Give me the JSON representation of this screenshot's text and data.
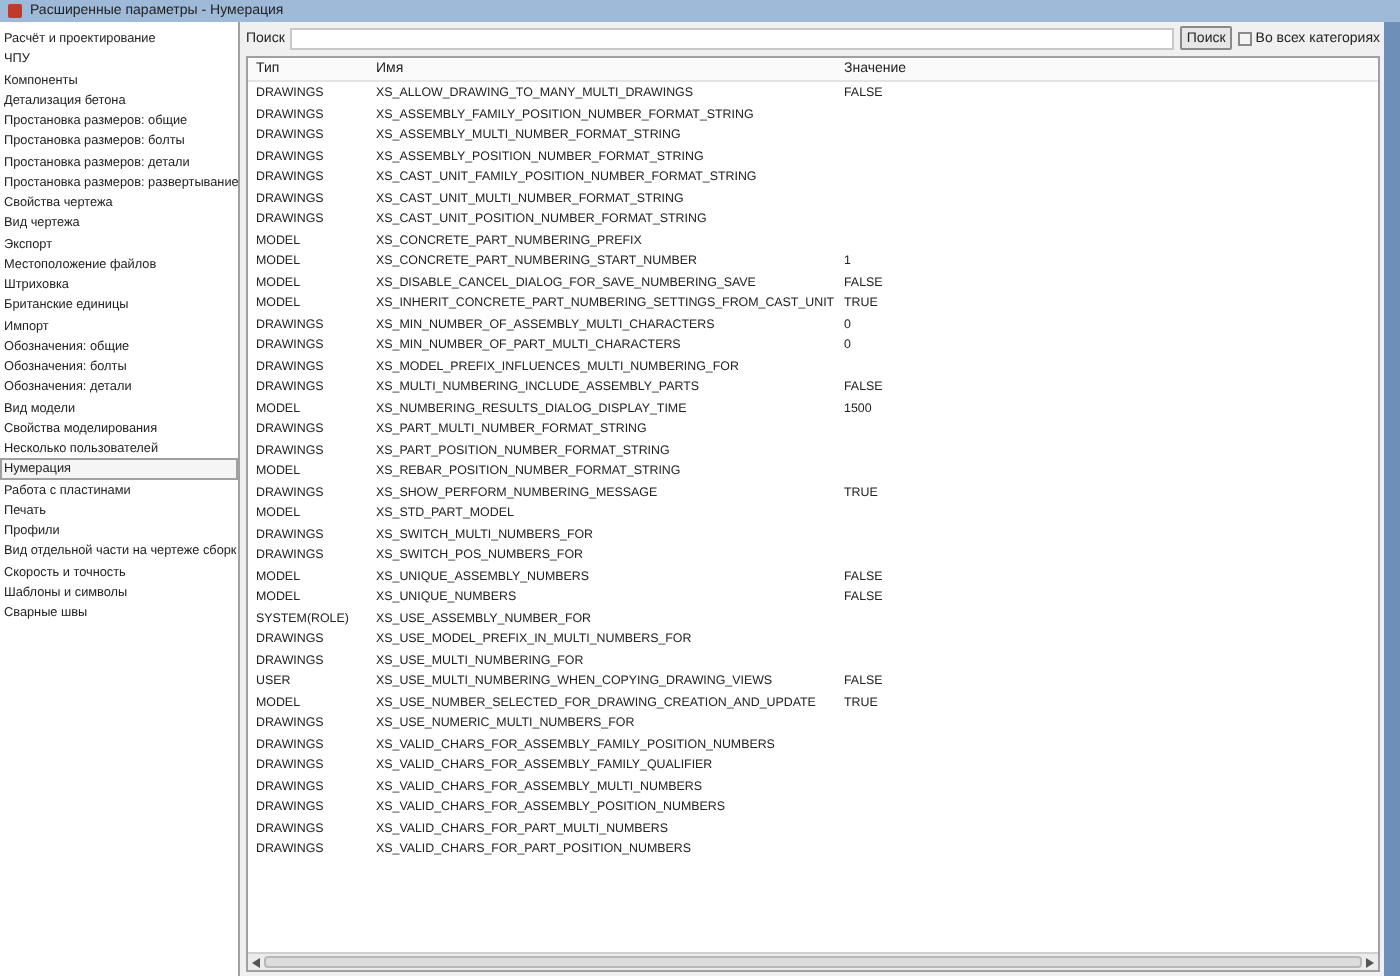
{
  "window": {
    "title": "Расширенные параметры - Нумерация"
  },
  "sidebar": {
    "items": [
      {
        "label": "Расчёт и проектирование",
        "selected": false
      },
      {
        "label": "ЧПУ",
        "selected": false
      },
      {
        "label": "Компоненты",
        "selected": false
      },
      {
        "label": "Детализация бетона",
        "selected": false
      },
      {
        "label": "Простановка размеров: общие",
        "selected": false
      },
      {
        "label": "Простановка размеров: болты",
        "selected": false
      },
      {
        "label": "Простановка размеров: детали",
        "selected": false
      },
      {
        "label": "Простановка размеров: развертывание",
        "selected": false
      },
      {
        "label": "Свойства чертежа",
        "selected": false
      },
      {
        "label": "Вид чертежа",
        "selected": false
      },
      {
        "label": "Экспорт",
        "selected": false
      },
      {
        "label": "Местоположение файлов",
        "selected": false
      },
      {
        "label": "Штриховка",
        "selected": false
      },
      {
        "label": "Британские единицы",
        "selected": false
      },
      {
        "label": "Импорт",
        "selected": false
      },
      {
        "label": "Обозначения: общие",
        "selected": false
      },
      {
        "label": "Обозначения: болты",
        "selected": false
      },
      {
        "label": "Обозначения: детали",
        "selected": false
      },
      {
        "label": "Вид модели",
        "selected": false
      },
      {
        "label": "Свойства моделирования",
        "selected": false
      },
      {
        "label": "Несколько пользователей",
        "selected": false
      },
      {
        "label": "Нумерация",
        "selected": true
      },
      {
        "label": "Работа с пластинами",
        "selected": false
      },
      {
        "label": "Печать",
        "selected": false
      },
      {
        "label": "Профили",
        "selected": false
      },
      {
        "label": "Вид отдельной части на чертеже сборк",
        "selected": false
      },
      {
        "label": "Скорость и точность",
        "selected": false
      },
      {
        "label": "Шаблоны и символы",
        "selected": false
      },
      {
        "label": "Сварные швы",
        "selected": false
      }
    ]
  },
  "search": {
    "label": "Поиск",
    "button": "Поиск",
    "all_categories": {
      "label": "Во всех категориях",
      "checked": false
    }
  },
  "table": {
    "columns": [
      "Тип",
      "Имя",
      "Значение"
    ],
    "rows": [
      [
        "DRAWINGS",
        "XS_ALLOW_DRAWING_TO_MANY_MULTI_DRAWINGS",
        "FALSE"
      ],
      [
        "DRAWINGS",
        "XS_ASSEMBLY_FAMILY_POSITION_NUMBER_FORMAT_STRING",
        ""
      ],
      [
        "DRAWINGS",
        "XS_ASSEMBLY_MULTI_NUMBER_FORMAT_STRING",
        ""
      ],
      [
        "DRAWINGS",
        "XS_ASSEMBLY_POSITION_NUMBER_FORMAT_STRING",
        ""
      ],
      [
        "DRAWINGS",
        "XS_CAST_UNIT_FAMILY_POSITION_NUMBER_FORMAT_STRING",
        ""
      ],
      [
        "DRAWINGS",
        "XS_CAST_UNIT_MULTI_NUMBER_FORMAT_STRING",
        ""
      ],
      [
        "DRAWINGS",
        "XS_CAST_UNIT_POSITION_NUMBER_FORMAT_STRING",
        ""
      ],
      [
        "MODEL",
        "XS_CONCRETE_PART_NUMBERING_PREFIX",
        ""
      ],
      [
        "MODEL",
        "XS_CONCRETE_PART_NUMBERING_START_NUMBER",
        "1"
      ],
      [
        "MODEL",
        "XS_DISABLE_CANCEL_DIALOG_FOR_SAVE_NUMBERING_SAVE",
        "FALSE"
      ],
      [
        "MODEL",
        "XS_INHERIT_CONCRETE_PART_NUMBERING_SETTINGS_FROM_CAST_UNIT",
        "TRUE"
      ],
      [
        "DRAWINGS",
        "XS_MIN_NUMBER_OF_ASSEMBLY_MULTI_CHARACTERS",
        "0"
      ],
      [
        "DRAWINGS",
        "XS_MIN_NUMBER_OF_PART_MULTI_CHARACTERS",
        "0"
      ],
      [
        "DRAWINGS",
        "XS_MODEL_PREFIX_INFLUENCES_MULTI_NUMBERING_FOR",
        ""
      ],
      [
        "DRAWINGS",
        "XS_MULTI_NUMBERING_INCLUDE_ASSEMBLY_PARTS",
        "FALSE"
      ],
      [
        "MODEL",
        "XS_NUMBERING_RESULTS_DIALOG_DISPLAY_TIME",
        "1500"
      ],
      [
        "DRAWINGS",
        "XS_PART_MULTI_NUMBER_FORMAT_STRING",
        ""
      ],
      [
        "DRAWINGS",
        "XS_PART_POSITION_NUMBER_FORMAT_STRING",
        ""
      ],
      [
        "MODEL",
        "XS_REBAR_POSITION_NUMBER_FORMAT_STRING",
        ""
      ],
      [
        "DRAWINGS",
        "XS_SHOW_PERFORM_NUMBERING_MESSAGE",
        "TRUE"
      ],
      [
        "MODEL",
        "XS_STD_PART_MODEL",
        ""
      ],
      [
        "DRAWINGS",
        "XS_SWITCH_MULTI_NUMBERS_FOR",
        ""
      ],
      [
        "DRAWINGS",
        "XS_SWITCH_POS_NUMBERS_FOR",
        ""
      ],
      [
        "MODEL",
        "XS_UNIQUE_ASSEMBLY_NUMBERS",
        "FALSE"
      ],
      [
        "MODEL",
        "XS_UNIQUE_NUMBERS",
        "FALSE"
      ],
      [
        "SYSTEM(ROLE)",
        "XS_USE_ASSEMBLY_NUMBER_FOR",
        ""
      ],
      [
        "DRAWINGS",
        "XS_USE_MODEL_PREFIX_IN_MULTI_NUMBERS_FOR",
        ""
      ],
      [
        "DRAWINGS",
        "XS_USE_MULTI_NUMBERING_FOR",
        ""
      ],
      [
        "USER",
        "XS_USE_MULTI_NUMBERING_WHEN_COPYING_DRAWING_VIEWS",
        "FALSE"
      ],
      [
        "MODEL",
        "XS_USE_NUMBER_SELECTED_FOR_DRAWING_CREATION_AND_UPDATE",
        "TRUE"
      ],
      [
        "DRAWINGS",
        "XS_USE_NUMERIC_MULTI_NUMBERS_FOR",
        ""
      ],
      [
        "DRAWINGS",
        "XS_VALID_CHARS_FOR_ASSEMBLY_FAMILY_POSITION_NUMBERS",
        ""
      ],
      [
        "DRAWINGS",
        "XS_VALID_CHARS_FOR_ASSEMBLY_FAMILY_QUALIFIER",
        ""
      ],
      [
        "DRAWINGS",
        "XS_VALID_CHARS_FOR_ASSEMBLY_MULTI_NUMBERS",
        ""
      ],
      [
        "DRAWINGS",
        "XS_VALID_CHARS_FOR_ASSEMBLY_POSITION_NUMBERS",
        ""
      ],
      [
        "DRAWINGS",
        "XS_VALID_CHARS_FOR_PART_MULTI_NUMBERS",
        ""
      ],
      [
        "DRAWINGS",
        "XS_VALID_CHARS_FOR_PART_POSITION_NUMBERS",
        ""
      ]
    ]
  }
}
